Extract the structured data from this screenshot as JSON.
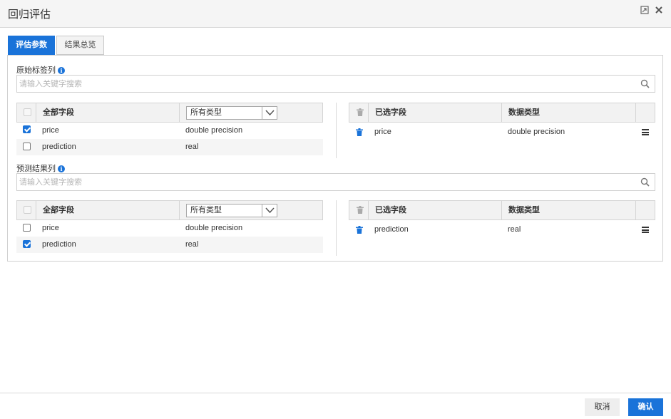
{
  "window": {
    "title": "回归评估"
  },
  "tabs": [
    {
      "label": "评估参数",
      "active": true
    },
    {
      "label": "结果总览",
      "active": false
    }
  ],
  "sections": [
    {
      "label": "原始标签列",
      "search_placeholder": "请输入关键字搜索",
      "left": {
        "header_all": "全部字段",
        "type_filter": "所有类型",
        "rows": [
          {
            "name": "price",
            "type": "double precision",
            "checked": true
          },
          {
            "name": "prediction",
            "type": "real",
            "checked": false
          }
        ]
      },
      "right": {
        "header_selected": "已选字段",
        "header_type": "数据类型",
        "rows": [
          {
            "name": "price",
            "type": "double precision"
          }
        ]
      }
    },
    {
      "label": "预测结果列",
      "search_placeholder": "请输入关键字搜索",
      "left": {
        "header_all": "全部字段",
        "type_filter": "所有类型",
        "rows": [
          {
            "name": "price",
            "type": "double precision",
            "checked": false
          },
          {
            "name": "prediction",
            "type": "real",
            "checked": true
          }
        ]
      },
      "right": {
        "header_selected": "已选字段",
        "header_type": "数据类型",
        "rows": [
          {
            "name": "prediction",
            "type": "real"
          }
        ]
      }
    }
  ],
  "footer": {
    "cancel_label": "取消",
    "ok_label": "确认"
  },
  "icons": {
    "info": "i"
  },
  "colors": {
    "accent": "#1a73d9",
    "header_bg": "#f2f2f2"
  }
}
